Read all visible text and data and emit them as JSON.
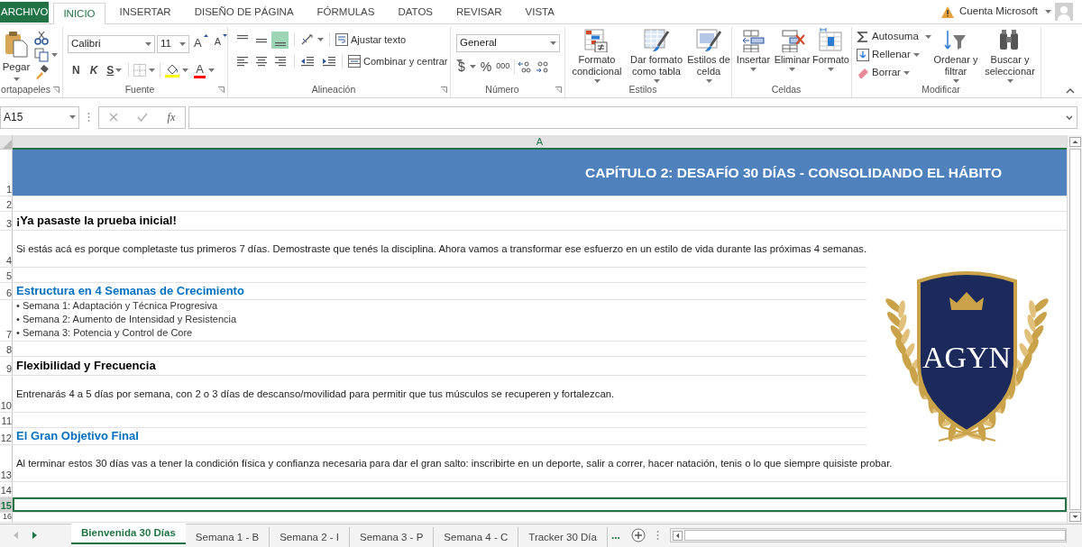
{
  "tabs": [
    {
      "label": "ARCHIVO",
      "kind": "file",
      "selected": false
    },
    {
      "label": "INICIO",
      "kind": "tab",
      "selected": true
    },
    {
      "label": "INSERTAR",
      "kind": "tab",
      "selected": false
    },
    {
      "label": "DISEÑO DE PÁGINA",
      "kind": "tab",
      "selected": false
    },
    {
      "label": "FÓRMULAS",
      "kind": "tab",
      "selected": false
    },
    {
      "label": "DATOS",
      "kind": "tab",
      "selected": false
    },
    {
      "label": "REVISAR",
      "kind": "tab",
      "selected": false
    },
    {
      "label": "VISTA",
      "kind": "tab",
      "selected": false
    }
  ],
  "account": {
    "label": "Cuenta Microsoft"
  },
  "ribbon": {
    "clipboard": {
      "label": "ortapapeles",
      "paste": "Pegar"
    },
    "font": {
      "label": "Fuente",
      "name": "Calibri",
      "size": "11",
      "grow": "A",
      "shrink": "A",
      "bold": "N",
      "italic": "K",
      "underline": "S",
      "font_color_label": "A"
    },
    "alignment": {
      "label": "Alineación",
      "wrap": "Ajustar texto",
      "merge": "Combinar y centrar",
      "vertical": [
        {
          "selected": false
        },
        {
          "selected": false
        },
        {
          "selected": true
        }
      ]
    },
    "number": {
      "label": "Número",
      "format": "General",
      "currency": "$",
      "percent": "%",
      "thousands": "000"
    },
    "styles": {
      "label": "Estilos",
      "buttons": [
        {
          "kind": "conditional",
          "lines": [
            "Formato",
            "condicional"
          ]
        },
        {
          "kind": "table",
          "lines": [
            "Dar formato",
            "como tabla"
          ]
        },
        {
          "kind": "cellstyle",
          "lines": [
            "Estilos de",
            "celda"
          ]
        }
      ]
    },
    "cells": {
      "label": "Celdas",
      "buttons": [
        {
          "kind": "insert",
          "lines": [
            "Insertar"
          ]
        },
        {
          "kind": "delete",
          "lines": [
            "Eliminar"
          ]
        },
        {
          "kind": "format",
          "lines": [
            "Formato"
          ]
        }
      ]
    },
    "editing": {
      "label": "Modificar",
      "autosum": "Autosuma",
      "fill": "Rellenar",
      "clear": "Borrar",
      "buttons": [
        {
          "kind": "sort",
          "lines": [
            "Ordenar y",
            "filtrar"
          ]
        },
        {
          "kind": "find",
          "lines": [
            "Buscar y",
            "seleccionar"
          ]
        }
      ]
    }
  },
  "formula_bar": {
    "name_box": "A15",
    "fx": "fx"
  },
  "sheet": {
    "column": "A",
    "logo": {
      "text": "AGYN"
    },
    "rows": [
      {
        "number": "1",
        "kind": "banner",
        "selected": false,
        "text": "CAPÍTULO 2: DESAFÍO 30 DÍAS - CONSOLIDANDO EL HÁBITO"
      },
      {
        "number": "2",
        "kind": "blank",
        "selected": false
      },
      {
        "number": "3",
        "kind": "heading",
        "selected": false,
        "text": "¡Ya pasaste la prueba inicial!"
      },
      {
        "number": "4",
        "kind": "body",
        "selected": false,
        "text": "Si estás acá es porque completaste tus primeros 7 días. Demostraste que tenés la disciplina. Ahora vamos a transformar ese esfuerzo en un estilo de vida durante las próximas 4 semanas."
      },
      {
        "number": "5",
        "kind": "blank",
        "selected": false
      },
      {
        "number": "6",
        "kind": "accent",
        "selected": false,
        "text": "Estructura en 4 Semanas de Crecimiento"
      },
      {
        "number": "7",
        "kind": "list",
        "selected": false,
        "items": [
          "• Semana 1: Adaptación y Técnica Progresiva",
          "• Semana 2: Aumento de Intensidad y Resistencia",
          "• Semana 3: Potencia y Control de Core"
        ]
      },
      {
        "number": "8",
        "kind": "blank",
        "selected": false
      },
      {
        "number": "9",
        "kind": "heading",
        "selected": false,
        "text": "Flexibilidad y Frecuencia"
      },
      {
        "number": "10",
        "kind": "body",
        "selected": false,
        "text": "Entrenarás 4 a 5 días por semana, con 2 o 3 días de descanso/movilidad para permitir que tus músculos se recuperen y fortalezcan."
      },
      {
        "number": "11",
        "kind": "blank",
        "selected": false
      },
      {
        "number": "12",
        "kind": "accent",
        "selected": false,
        "text": "El Gran Objetivo Final"
      },
      {
        "number": "13",
        "kind": "body",
        "selected": false,
        "text": "Al terminar estos 30 días vas a tener la condición física y confianza necesaria para dar el gran salto: inscribirte en un deporte, salir a correr, hacer natación, tenis o lo que siempre quisiste probar."
      },
      {
        "number": "14",
        "kind": "blank",
        "selected": false
      },
      {
        "number": "15",
        "kind": "blank",
        "selected": true
      },
      {
        "number": "16",
        "kind": "last",
        "selected": false
      }
    ]
  },
  "sheet_tabs": [
    {
      "label": "Bienvenida 30 Días",
      "selected": true
    },
    {
      "label": "Semana 1 - B",
      "selected": false
    },
    {
      "label": "Semana 2 - I",
      "selected": false
    },
    {
      "label": "Semana 3 - P",
      "selected": false
    },
    {
      "label": "Semana 4 - C",
      "selected": false
    },
    {
      "label": "Tracker 30 Día",
      "selected": false
    }
  ],
  "more_tabs": "..."
}
